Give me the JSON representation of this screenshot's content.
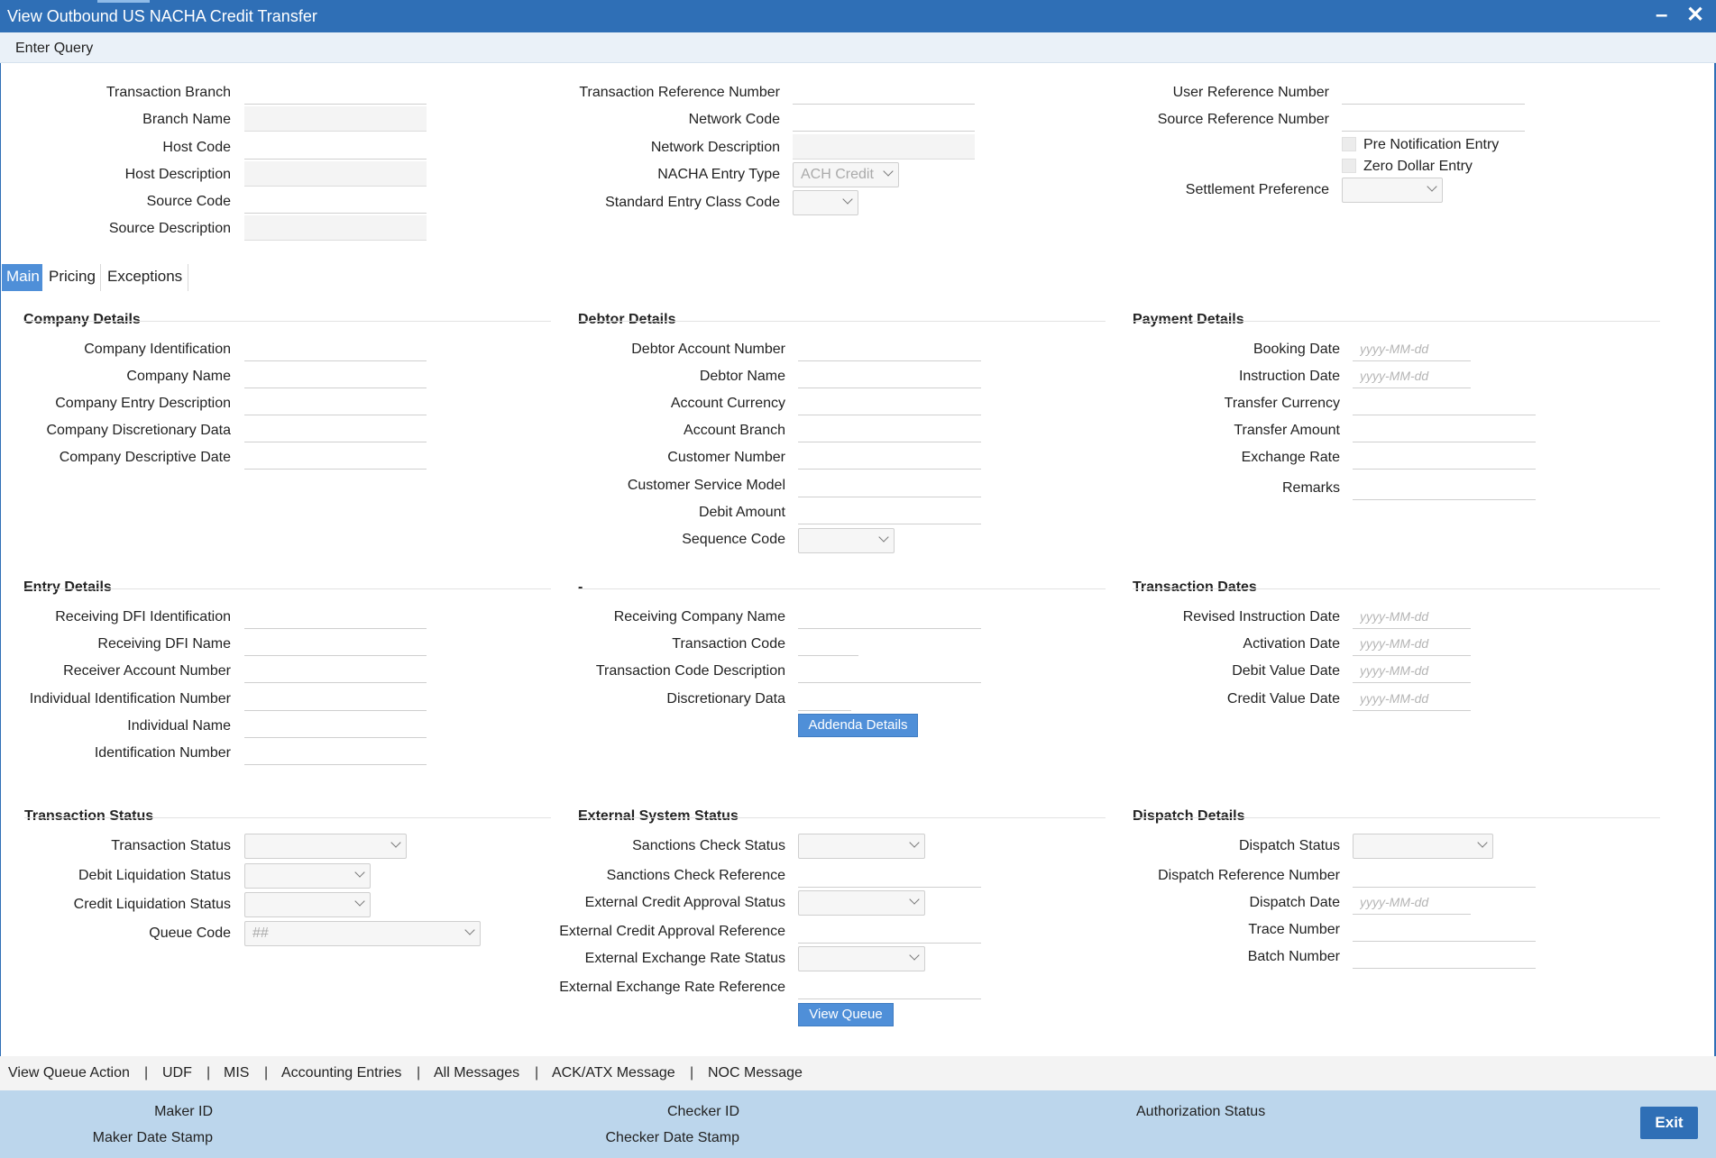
{
  "window": {
    "title": "View Outbound US NACHA Credit Transfer",
    "minimize_icon": "minimize-icon",
    "close_icon": "close-icon"
  },
  "toolbar": {
    "enter_query": "Enter Query"
  },
  "header": {
    "col1": {
      "transaction_branch": "Transaction Branch",
      "branch_name": "Branch Name",
      "host_code": "Host Code",
      "host_description": "Host Description",
      "source_code": "Source Code",
      "source_description": "Source Description"
    },
    "col2": {
      "transaction_reference_number": "Transaction Reference Number",
      "network_code": "Network Code",
      "network_description": "Network Description",
      "nacha_entry_type": "NACHA Entry Type",
      "nacha_entry_type_value": "ACH Credit",
      "standard_entry_class_code": "Standard Entry Class Code"
    },
    "col3": {
      "user_reference_number": "User Reference Number",
      "source_reference_number": "Source Reference Number",
      "pre_notification_entry": "Pre Notification Entry",
      "zero_dollar_entry": "Zero Dollar Entry",
      "settlement_preference": "Settlement Preference"
    }
  },
  "tabs": {
    "main": "Main",
    "pricing": "Pricing",
    "exceptions": "Exceptions"
  },
  "date_placeholder": "yyyy-MM-dd",
  "company_details": {
    "title": "Company Details",
    "company_identification": "Company Identification",
    "company_name": "Company Name",
    "company_entry_description": "Company Entry Description",
    "company_discretionary_data": "Company Discretionary Data",
    "company_descriptive_date": "Company Descriptive Date"
  },
  "debtor_details": {
    "title": "Debtor Details",
    "debtor_account_number": "Debtor Account Number",
    "debtor_name": "Debtor Name",
    "account_currency": "Account Currency",
    "account_branch": "Account Branch",
    "customer_number": "Customer Number",
    "customer_service_model": "Customer Service Model",
    "debit_amount": "Debit Amount",
    "sequence_code": "Sequence Code"
  },
  "payment_details": {
    "title": "Payment Details",
    "booking_date": "Booking Date",
    "instruction_date": "Instruction Date",
    "transfer_currency": "Transfer Currency",
    "transfer_amount": "Transfer Amount",
    "exchange_rate": "Exchange Rate",
    "remarks": "Remarks"
  },
  "entry_details": {
    "title": "Entry Details",
    "receiving_dfi_identification": "Receiving DFI Identification",
    "receiving_dfi_name": "Receiving DFI Name",
    "receiver_account_number": "Receiver Account Number",
    "individual_identification_number": "Individual Identification Number",
    "individual_name": "Individual Name",
    "identification_number": "Identification Number"
  },
  "receiving_company": {
    "title": "-",
    "receiving_company_name": "Receiving Company Name",
    "transaction_code": "Transaction Code",
    "transaction_code_description": "Transaction Code Description",
    "discretionary_data": "Discretionary Data",
    "addenda_details_button": "Addenda Details"
  },
  "transaction_dates": {
    "title": "Transaction Dates",
    "revised_instruction_date": "Revised Instruction Date",
    "activation_date": "Activation Date",
    "debit_value_date": "Debit Value Date",
    "credit_value_date": "Credit Value Date"
  },
  "transaction_status": {
    "title": "Transaction Status",
    "transaction_status": "Transaction Status",
    "debit_liquidation_status": "Debit Liquidation Status",
    "credit_liquidation_status": "Credit Liquidation Status",
    "queue_code": "Queue Code",
    "queue_code_value": "##"
  },
  "external_system_status": {
    "title": "External System Status",
    "sanctions_check_status": "Sanctions Check Status",
    "sanctions_check_reference": "Sanctions Check Reference",
    "external_credit_approval_status": "External Credit Approval Status",
    "external_credit_approval_reference": "External Credit Approval Reference",
    "external_exchange_rate_status": "External Exchange Rate Status",
    "external_exchange_rate_reference": "External Exchange Rate Reference",
    "view_queue_button": "View Queue"
  },
  "dispatch_details": {
    "title": "Dispatch Details",
    "dispatch_status": "Dispatch Status",
    "dispatch_reference_number": "Dispatch Reference Number",
    "dispatch_date": "Dispatch Date",
    "trace_number": "Trace Number",
    "batch_number": "Batch Number"
  },
  "footer_links": {
    "view_queue_action": "View Queue Action",
    "udf": "UDF",
    "mis": "MIS",
    "accounting_entries": "Accounting Entries",
    "all_messages": "All Messages",
    "ack_atx_message": "ACK/ATX Message",
    "noc_message": "NOC Message",
    "separator": "|"
  },
  "audit": {
    "maker_id": "Maker ID",
    "maker_date_stamp": "Maker Date Stamp",
    "checker_id": "Checker ID",
    "checker_date_stamp": "Checker Date Stamp",
    "authorization_status": "Authorization Status",
    "exit_button": "Exit"
  },
  "colors": {
    "title_bar": "#2f6fb6",
    "accent_button": "#4f8fd8",
    "audit_bar": "#bcd6ec"
  }
}
